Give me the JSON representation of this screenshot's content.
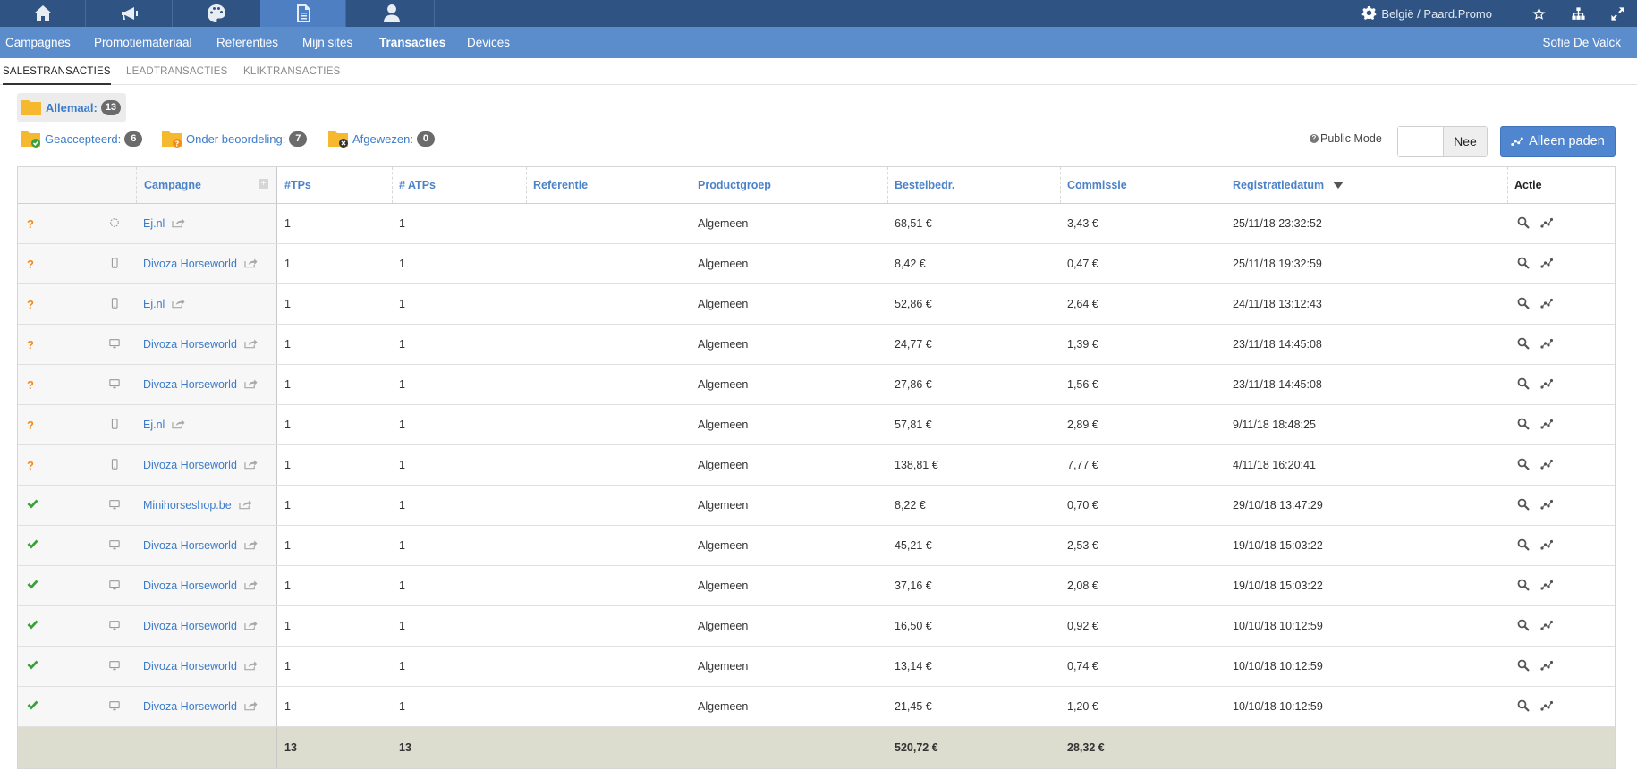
{
  "topbar": {
    "region_label": "België / Paard.Promo",
    "tabs": [
      "home-icon",
      "megaphone-icon",
      "palette-icon",
      "document-icon",
      "user-icon"
    ]
  },
  "menu": {
    "items": [
      "Campagnes",
      "Promotiemateriaal",
      "Referenties",
      "Mijn sites",
      "Transacties",
      "Devices"
    ],
    "active": "Transacties",
    "user": "Sofie De Valck"
  },
  "subtabs": [
    "SALESTRANSACTIES",
    "LEADTRANSACTIES",
    "KLIKTRANSACTIES"
  ],
  "filters": {
    "all": {
      "label": "Allemaal:",
      "count": "13"
    },
    "accepted": {
      "label": "Geaccepteerd:",
      "count": "6"
    },
    "pending": {
      "label": "Onder beoordeling:",
      "count": "7"
    },
    "rejected": {
      "label": "Afgewezen:",
      "count": "0"
    }
  },
  "public_mode": {
    "label": "Public Mode",
    "toggle_value": "Nee"
  },
  "alleen_paden": "Alleen paden",
  "table": {
    "columns": {
      "campagne": "Campagne",
      "tps": "#TPs",
      "atps": "# ATPs",
      "referentie": "Referentie",
      "productgroep": "Productgroep",
      "bestelbedr": "Bestelbedr.",
      "commissie": "Commissie",
      "registratiedatum": "Registratiedatum",
      "actie": "Actie"
    },
    "rows": [
      {
        "status": "?",
        "device": "loading",
        "campagne": "Ej.nl",
        "tps": "1",
        "atps": "1",
        "ref": "",
        "productgroep": "Algemeen",
        "bestelbedr": "68,51 €",
        "commissie": "3,43 €",
        "datum": "25/11/18 23:32:52"
      },
      {
        "status": "?",
        "device": "mobile",
        "campagne": "Divoza Horseworld",
        "tps": "1",
        "atps": "1",
        "ref": "",
        "productgroep": "Algemeen",
        "bestelbedr": "8,42 €",
        "commissie": "0,47 €",
        "datum": "25/11/18 19:32:59"
      },
      {
        "status": "?",
        "device": "mobile",
        "campagne": "Ej.nl",
        "tps": "1",
        "atps": "1",
        "ref": "",
        "productgroep": "Algemeen",
        "bestelbedr": "52,86 €",
        "commissie": "2,64 €",
        "datum": "24/11/18 13:12:43"
      },
      {
        "status": "?",
        "device": "desktop",
        "campagne": "Divoza Horseworld",
        "tps": "1",
        "atps": "1",
        "ref": "",
        "productgroep": "Algemeen",
        "bestelbedr": "24,77 €",
        "commissie": "1,39 €",
        "datum": "23/11/18 14:45:08"
      },
      {
        "status": "?",
        "device": "desktop",
        "campagne": "Divoza Horseworld",
        "tps": "1",
        "atps": "1",
        "ref": "",
        "productgroep": "Algemeen",
        "bestelbedr": "27,86 €",
        "commissie": "1,56 €",
        "datum": "23/11/18 14:45:08"
      },
      {
        "status": "?",
        "device": "mobile",
        "campagne": "Ej.nl",
        "tps": "1",
        "atps": "1",
        "ref": "",
        "productgroep": "Algemeen",
        "bestelbedr": "57,81 €",
        "commissie": "2,89 €",
        "datum": "9/11/18 18:48:25"
      },
      {
        "status": "?",
        "device": "mobile",
        "campagne": "Divoza Horseworld",
        "tps": "1",
        "atps": "1",
        "ref": "",
        "productgroep": "Algemeen",
        "bestelbedr": "138,81 €",
        "commissie": "7,77 €",
        "datum": "4/11/18 16:20:41"
      },
      {
        "status": "ok",
        "device": "desktop",
        "campagne": "Minihorseshop.be",
        "tps": "1",
        "atps": "1",
        "ref": "",
        "productgroep": "Algemeen",
        "bestelbedr": "8,22 €",
        "commissie": "0,70 €",
        "datum": "29/10/18 13:47:29"
      },
      {
        "status": "ok",
        "device": "desktop",
        "campagne": "Divoza Horseworld",
        "tps": "1",
        "atps": "1",
        "ref": "",
        "productgroep": "Algemeen",
        "bestelbedr": "45,21 €",
        "commissie": "2,53 €",
        "datum": "19/10/18 15:03:22"
      },
      {
        "status": "ok",
        "device": "desktop",
        "campagne": "Divoza Horseworld",
        "tps": "1",
        "atps": "1",
        "ref": "",
        "productgroep": "Algemeen",
        "bestelbedr": "37,16 €",
        "commissie": "2,08 €",
        "datum": "19/10/18 15:03:22"
      },
      {
        "status": "ok",
        "device": "desktop",
        "campagne": "Divoza Horseworld",
        "tps": "1",
        "atps": "1",
        "ref": "",
        "productgroep": "Algemeen",
        "bestelbedr": "16,50 €",
        "commissie": "0,92 €",
        "datum": "10/10/18 10:12:59"
      },
      {
        "status": "ok",
        "device": "desktop",
        "campagne": "Divoza Horseworld",
        "tps": "1",
        "atps": "1",
        "ref": "",
        "productgroep": "Algemeen",
        "bestelbedr": "13,14 €",
        "commissie": "0,74 €",
        "datum": "10/10/18 10:12:59"
      },
      {
        "status": "ok",
        "device": "desktop",
        "campagne": "Divoza Horseworld",
        "tps": "1",
        "atps": "1",
        "ref": "",
        "productgroep": "Algemeen",
        "bestelbedr": "21,45 €",
        "commissie": "1,20 €",
        "datum": "10/10/18 10:12:59"
      }
    ],
    "totals": {
      "tps": "13",
      "atps": "13",
      "bestelbedr": "520,72 €",
      "commissie": "28,32 €"
    }
  },
  "colors": {
    "topbar": "#2f5383",
    "menubar": "#5b8dcd",
    "link": "#3d7cc9",
    "pending": "#f08c1e",
    "accepted": "#3aa13a",
    "total_row": "#dcdccf"
  }
}
